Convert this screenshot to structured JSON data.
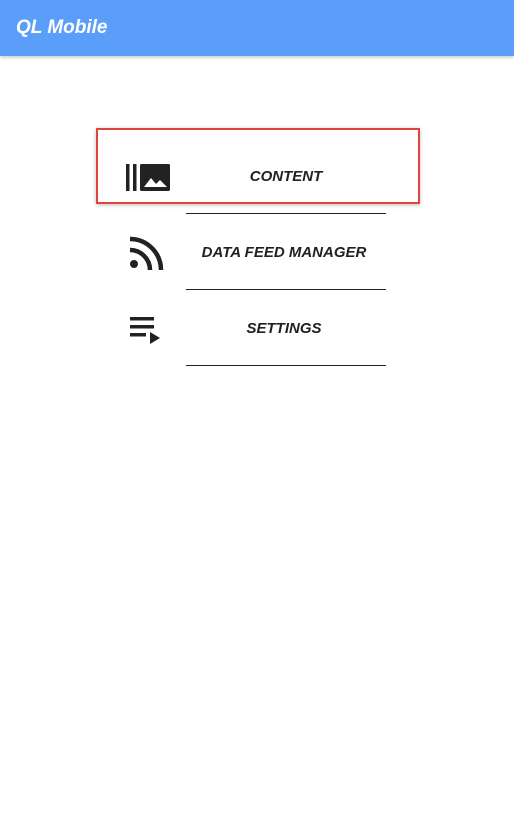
{
  "app_bar": {
    "title": "QL Mobile",
    "color": "#5b9ef9"
  },
  "menu": {
    "items": [
      {
        "label": "CONTENT",
        "icon": "photo-library-icon",
        "selected": true
      },
      {
        "label": "DATA FEED MANAGER",
        "icon": "rss-feed-icon",
        "selected": false
      },
      {
        "label": "SETTINGS",
        "icon": "playlist-play-icon",
        "selected": false
      }
    ]
  }
}
